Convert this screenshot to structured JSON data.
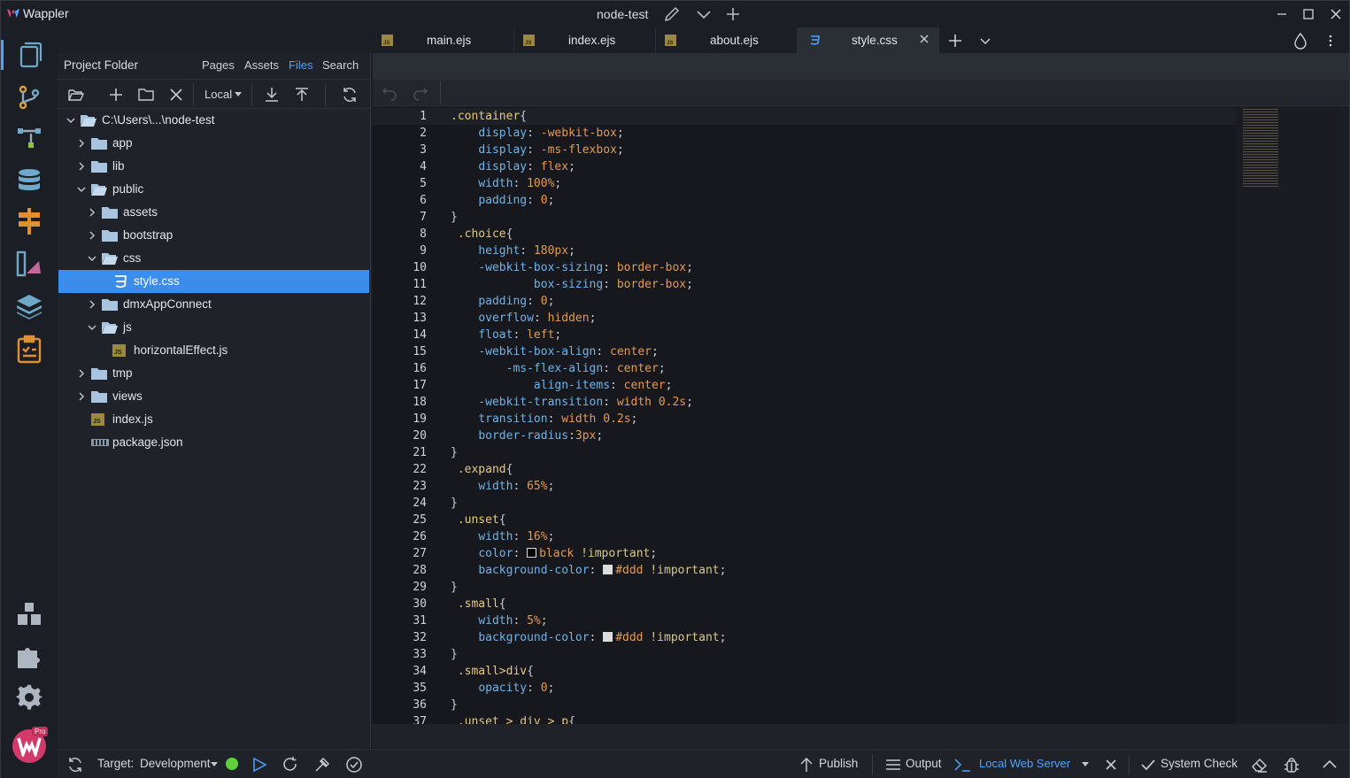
{
  "app": {
    "name": "Wappler",
    "project": "node-test"
  },
  "tabs": [
    {
      "label": "main.ejs",
      "type": "js"
    },
    {
      "label": "index.ejs",
      "type": "js"
    },
    {
      "label": "about.ejs",
      "type": "js"
    },
    {
      "label": "style.css",
      "type": "css",
      "active": true
    }
  ],
  "panel": {
    "title": "Project Folder",
    "tabs": [
      "Pages",
      "Assets",
      "Files",
      "Search"
    ],
    "selected_tab": "Files",
    "location": "Local"
  },
  "tree": [
    {
      "name": "C:\\Users\\...\\node-test",
      "depth": 0,
      "type": "folder-open",
      "chev": "down"
    },
    {
      "name": "app",
      "depth": 1,
      "type": "folder",
      "chev": "right"
    },
    {
      "name": "lib",
      "depth": 1,
      "type": "folder",
      "chev": "right"
    },
    {
      "name": "public",
      "depth": 1,
      "type": "folder-open",
      "chev": "down"
    },
    {
      "name": "assets",
      "depth": 2,
      "type": "folder",
      "chev": "right"
    },
    {
      "name": "bootstrap",
      "depth": 2,
      "type": "folder",
      "chev": "right"
    },
    {
      "name": "css",
      "depth": 2,
      "type": "folder-open",
      "chev": "down"
    },
    {
      "name": "style.css",
      "depth": 3,
      "type": "css",
      "selected": true
    },
    {
      "name": "dmxAppConnect",
      "depth": 2,
      "type": "folder",
      "chev": "right"
    },
    {
      "name": "js",
      "depth": 2,
      "type": "folder-open",
      "chev": "down"
    },
    {
      "name": "horizontalEffect.js",
      "depth": 3,
      "type": "js"
    },
    {
      "name": "tmp",
      "depth": 1,
      "type": "folder",
      "chev": "right"
    },
    {
      "name": "views",
      "depth": 1,
      "type": "folder",
      "chev": "right"
    },
    {
      "name": "index.js",
      "depth": 1,
      "type": "js"
    },
    {
      "name": "package.json",
      "depth": 1,
      "type": "json"
    }
  ],
  "code_lines": [
    ".container{",
    "    display: -webkit-box;",
    "    display: -ms-flexbox;",
    "    display: flex;",
    "    width: 100%;",
    "    padding: 0;",
    "}",
    " .choice{",
    "    height: 180px;",
    "    -webkit-box-sizing: border-box;",
    "            box-sizing: border-box;",
    "    padding: 0;",
    "    overflow: hidden;",
    "    float: left;",
    "    -webkit-box-align: center;",
    "        -ms-flex-align: center;",
    "            align-items: center;",
    "    -webkit-transition: width 0.2s;",
    "    transition: width 0.2s;",
    "    border-radius:3px;",
    "}",
    " .expand{",
    "    width: 65%;",
    "}",
    " .unset{",
    "    width: 16%;",
    "    color: black !important;",
    "    background-color: #ddd !important;",
    "}",
    " .small{",
    "    width: 5%;",
    "    background-color: #ddd !important;",
    "}",
    " .small>div{",
    "    opacity: 0;",
    "}",
    " .unset > div > p{"
  ],
  "status": {
    "target_label": "Target:",
    "target_value": "Development",
    "publish": "Publish",
    "output": "Output",
    "server": "Local Web Server",
    "system_check": "System Check",
    "badge": "Pro"
  },
  "colors": {
    "accent": "#4fa3ff",
    "selection": "#3b8de9",
    "selector": "#e6c884",
    "property": "#6fb3e8",
    "value": "#e39a54",
    "server_ok": "#5fcf3a"
  }
}
